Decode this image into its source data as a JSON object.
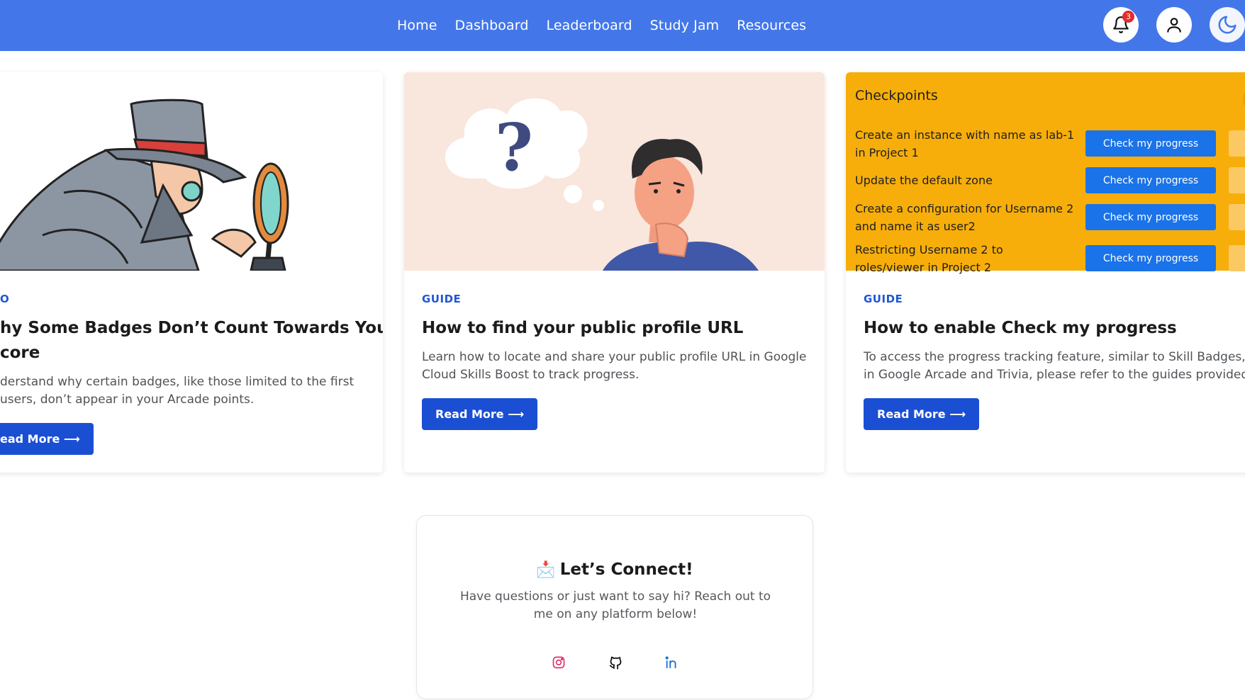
{
  "nav": {
    "links": [
      "Home",
      "Dashboard",
      "Leaderboard",
      "Study Jam",
      "Resources"
    ],
    "notification_count": "3"
  },
  "cards": [
    {
      "tag": "O",
      "title_line1": "hy Some Badges Don’t Count Towards Your",
      "title_line2": "core",
      "desc_line1": "derstand why certain badges, like those limited to the first",
      "desc_line2": "users, don’t appear in your Arcade points.",
      "button": "ead More ⟶"
    },
    {
      "tag": "GUIDE",
      "title": "How to find your public profile URL",
      "desc_line1": "Learn how to locate and share your public profile URL in Google",
      "desc_line2": "Cloud Skills Boost to track progress.",
      "button": "Read More ⟶"
    },
    {
      "tag": "GUIDE",
      "title": "How to enable Check my progress",
      "desc_line1": "To access the progress tracking feature, similar to Skill Badges,",
      "desc_line2": "in Google Arcade and Trivia, please refer to the guides provided.",
      "button": "Read More ⟶"
    }
  ],
  "checkpoints": {
    "heading": "Checkpoints",
    "items": [
      {
        "text": "Create an instance with name as lab-1 in Project 1",
        "button": "Check my progress"
      },
      {
        "text": "Update the default zone",
        "button": "Check my progress"
      },
      {
        "text": "Create a configuration for Username 2 and name it as user2",
        "button": "Check my progress"
      },
      {
        "text": "Restricting Username 2 to roles/viewer in Project 2",
        "button": "Check my progress"
      }
    ]
  },
  "connect": {
    "emoji": "📩",
    "title": "Let’s Connect!",
    "desc_line1": "Have questions or just want to say hi? Reach out to",
    "desc_line2": "me on any platform below!"
  },
  "colors": {
    "nav_bg": "#4377e9",
    "accent": "#1b4fd3",
    "checkpoint_bg": "#f7ae0a",
    "checkpoint_btn": "#1a73e8",
    "instagram": "#e1306c",
    "linkedin": "#1f6fd1"
  },
  "icons": [
    "bell-icon",
    "user-icon",
    "moon-icon",
    "instagram-icon",
    "github-icon",
    "linkedin-icon"
  ]
}
